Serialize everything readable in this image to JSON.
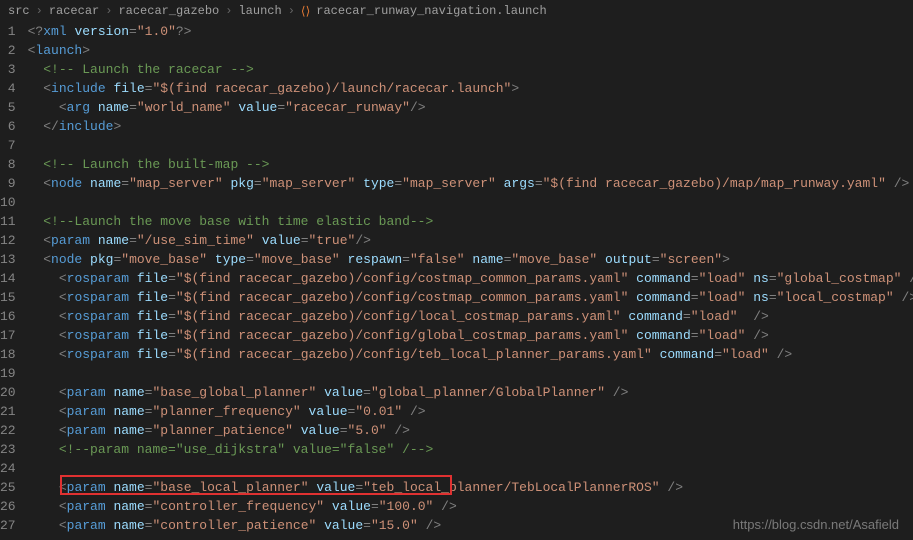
{
  "breadcrumb": {
    "items": [
      "src",
      "racecar",
      "racecar_gazebo",
      "launch",
      "racecar_runway_navigation.launch"
    ]
  },
  "gutter": {
    "start": 1,
    "end": 27
  },
  "code_lines": [
    {
      "i": 1,
      "tokens": [
        [
          "punc",
          "<?"
        ],
        [
          "tag",
          "xml "
        ],
        [
          "attr",
          "version"
        ],
        [
          "punc",
          "="
        ],
        [
          "str",
          "\"1.0\""
        ],
        [
          "punc",
          "?>"
        ]
      ]
    },
    {
      "i": 2,
      "tokens": [
        [
          "punc",
          "<"
        ],
        [
          "tag",
          "launch"
        ],
        [
          "punc",
          ">"
        ]
      ]
    },
    {
      "i": 3,
      "tokens": [
        [
          "txt",
          "  "
        ],
        [
          "cmt",
          "<!-- Launch the racecar -->"
        ]
      ]
    },
    {
      "i": 4,
      "tokens": [
        [
          "txt",
          "  "
        ],
        [
          "punc",
          "<"
        ],
        [
          "tag",
          "include "
        ],
        [
          "attr",
          "file"
        ],
        [
          "punc",
          "="
        ],
        [
          "str",
          "\"$(find racecar_gazebo)/launch/racecar.launch\""
        ],
        [
          "punc",
          ">"
        ]
      ]
    },
    {
      "i": 5,
      "tokens": [
        [
          "txt",
          "    "
        ],
        [
          "punc",
          "<"
        ],
        [
          "tag",
          "arg "
        ],
        [
          "attr",
          "name"
        ],
        [
          "punc",
          "="
        ],
        [
          "str",
          "\"world_name\" "
        ],
        [
          "attr",
          "value"
        ],
        [
          "punc",
          "="
        ],
        [
          "str",
          "\"racecar_runway\""
        ],
        [
          "punc",
          "/>"
        ]
      ]
    },
    {
      "i": 6,
      "tokens": [
        [
          "txt",
          "  "
        ],
        [
          "punc",
          "</"
        ],
        [
          "tag",
          "include"
        ],
        [
          "punc",
          ">"
        ]
      ]
    },
    {
      "i": 7,
      "tokens": []
    },
    {
      "i": 8,
      "tokens": [
        [
          "txt",
          "  "
        ],
        [
          "cmt",
          "<!-- Launch the built-map -->"
        ]
      ]
    },
    {
      "i": 9,
      "tokens": [
        [
          "txt",
          "  "
        ],
        [
          "punc",
          "<"
        ],
        [
          "tag",
          "node "
        ],
        [
          "attr",
          "name"
        ],
        [
          "punc",
          "="
        ],
        [
          "str",
          "\"map_server\" "
        ],
        [
          "attr",
          "pkg"
        ],
        [
          "punc",
          "="
        ],
        [
          "str",
          "\"map_server\" "
        ],
        [
          "attr",
          "type"
        ],
        [
          "punc",
          "="
        ],
        [
          "str",
          "\"map_server\" "
        ],
        [
          "attr",
          "args"
        ],
        [
          "punc",
          "="
        ],
        [
          "str",
          "\"$(find racecar_gazebo)/map/map_runway.yaml\" "
        ],
        [
          "punc",
          "/>"
        ]
      ]
    },
    {
      "i": 10,
      "tokens": []
    },
    {
      "i": 11,
      "tokens": [
        [
          "txt",
          "  "
        ],
        [
          "cmt",
          "<!--Launch the move base with time elastic band-->"
        ]
      ]
    },
    {
      "i": 12,
      "tokens": [
        [
          "txt",
          "  "
        ],
        [
          "punc",
          "<"
        ],
        [
          "tag",
          "param "
        ],
        [
          "attr",
          "name"
        ],
        [
          "punc",
          "="
        ],
        [
          "str",
          "\"/use_sim_time\" "
        ],
        [
          "attr",
          "value"
        ],
        [
          "punc",
          "="
        ],
        [
          "str",
          "\"true\""
        ],
        [
          "punc",
          "/>"
        ]
      ]
    },
    {
      "i": 13,
      "tokens": [
        [
          "txt",
          "  "
        ],
        [
          "punc",
          "<"
        ],
        [
          "tag",
          "node "
        ],
        [
          "attr",
          "pkg"
        ],
        [
          "punc",
          "="
        ],
        [
          "str",
          "\"move_base\" "
        ],
        [
          "attr",
          "type"
        ],
        [
          "punc",
          "="
        ],
        [
          "str",
          "\"move_base\" "
        ],
        [
          "attr",
          "respawn"
        ],
        [
          "punc",
          "="
        ],
        [
          "str",
          "\"false\" "
        ],
        [
          "attr",
          "name"
        ],
        [
          "punc",
          "="
        ],
        [
          "str",
          "\"move_base\" "
        ],
        [
          "attr",
          "output"
        ],
        [
          "punc",
          "="
        ],
        [
          "str",
          "\"screen\""
        ],
        [
          "punc",
          ">"
        ]
      ]
    },
    {
      "i": 14,
      "tokens": [
        [
          "txt",
          "    "
        ],
        [
          "punc",
          "<"
        ],
        [
          "tag",
          "rosparam "
        ],
        [
          "attr",
          "file"
        ],
        [
          "punc",
          "="
        ],
        [
          "str",
          "\"$(find racecar_gazebo)/config/costmap_common_params.yaml\" "
        ],
        [
          "attr",
          "command"
        ],
        [
          "punc",
          "="
        ],
        [
          "str",
          "\"load\" "
        ],
        [
          "attr",
          "ns"
        ],
        [
          "punc",
          "="
        ],
        [
          "str",
          "\"global_costmap\" "
        ],
        [
          "punc",
          "/>"
        ]
      ]
    },
    {
      "i": 15,
      "tokens": [
        [
          "txt",
          "    "
        ],
        [
          "punc",
          "<"
        ],
        [
          "tag",
          "rosparam "
        ],
        [
          "attr",
          "file"
        ],
        [
          "punc",
          "="
        ],
        [
          "str",
          "\"$(find racecar_gazebo)/config/costmap_common_params.yaml\" "
        ],
        [
          "attr",
          "command"
        ],
        [
          "punc",
          "="
        ],
        [
          "str",
          "\"load\" "
        ],
        [
          "attr",
          "ns"
        ],
        [
          "punc",
          "="
        ],
        [
          "str",
          "\"local_costmap\" "
        ],
        [
          "punc",
          "/>"
        ]
      ]
    },
    {
      "i": 16,
      "tokens": [
        [
          "txt",
          "    "
        ],
        [
          "punc",
          "<"
        ],
        [
          "tag",
          "rosparam "
        ],
        [
          "attr",
          "file"
        ],
        [
          "punc",
          "="
        ],
        [
          "str",
          "\"$(find racecar_gazebo)/config/local_costmap_params.yaml\" "
        ],
        [
          "attr",
          "command"
        ],
        [
          "punc",
          "="
        ],
        [
          "str",
          "\"load\"  "
        ],
        [
          "punc",
          "/>"
        ]
      ]
    },
    {
      "i": 17,
      "tokens": [
        [
          "txt",
          "    "
        ],
        [
          "punc",
          "<"
        ],
        [
          "tag",
          "rosparam "
        ],
        [
          "attr",
          "file"
        ],
        [
          "punc",
          "="
        ],
        [
          "str",
          "\"$(find racecar_gazebo)/config/global_costmap_params.yaml\" "
        ],
        [
          "attr",
          "command"
        ],
        [
          "punc",
          "="
        ],
        [
          "str",
          "\"load\" "
        ],
        [
          "punc",
          "/>"
        ]
      ]
    },
    {
      "i": 18,
      "tokens": [
        [
          "txt",
          "    "
        ],
        [
          "punc",
          "<"
        ],
        [
          "tag",
          "rosparam "
        ],
        [
          "attr",
          "file"
        ],
        [
          "punc",
          "="
        ],
        [
          "str",
          "\"$(find racecar_gazebo)/config/teb_local_planner_params.yaml\" "
        ],
        [
          "attr",
          "command"
        ],
        [
          "punc",
          "="
        ],
        [
          "str",
          "\"load\" "
        ],
        [
          "punc",
          "/>"
        ]
      ]
    },
    {
      "i": 19,
      "tokens": []
    },
    {
      "i": 20,
      "tokens": [
        [
          "txt",
          "    "
        ],
        [
          "punc",
          "<"
        ],
        [
          "tag",
          "param "
        ],
        [
          "attr",
          "name"
        ],
        [
          "punc",
          "="
        ],
        [
          "str",
          "\"base_global_planner\" "
        ],
        [
          "attr",
          "value"
        ],
        [
          "punc",
          "="
        ],
        [
          "str",
          "\"global_planner/GlobalPlanner\" "
        ],
        [
          "punc",
          "/>"
        ]
      ]
    },
    {
      "i": 21,
      "tokens": [
        [
          "txt",
          "    "
        ],
        [
          "punc",
          "<"
        ],
        [
          "tag",
          "param "
        ],
        [
          "attr",
          "name"
        ],
        [
          "punc",
          "="
        ],
        [
          "str",
          "\"planner_frequency\" "
        ],
        [
          "attr",
          "value"
        ],
        [
          "punc",
          "="
        ],
        [
          "str",
          "\"0.01\" "
        ],
        [
          "punc",
          "/>"
        ]
      ]
    },
    {
      "i": 22,
      "tokens": [
        [
          "txt",
          "    "
        ],
        [
          "punc",
          "<"
        ],
        [
          "tag",
          "param "
        ],
        [
          "attr",
          "name"
        ],
        [
          "punc",
          "="
        ],
        [
          "str",
          "\"planner_patience\" "
        ],
        [
          "attr",
          "value"
        ],
        [
          "punc",
          "="
        ],
        [
          "str",
          "\"5.0\" "
        ],
        [
          "punc",
          "/>"
        ]
      ]
    },
    {
      "i": 23,
      "tokens": [
        [
          "txt",
          "    "
        ],
        [
          "cmt",
          "<!--param name=\"use_dijkstra\" value=\"false\" /-->"
        ]
      ]
    },
    {
      "i": 24,
      "tokens": []
    },
    {
      "i": 25,
      "tokens": [
        [
          "txt",
          "    "
        ],
        [
          "punc",
          "<"
        ],
        [
          "tag",
          "param "
        ],
        [
          "attr",
          "name"
        ],
        [
          "punc",
          "="
        ],
        [
          "str",
          "\"base_local_planner\" "
        ],
        [
          "attr",
          "value"
        ],
        [
          "punc",
          "="
        ],
        [
          "str",
          "\"teb_local_planner/TebLocalPlannerROS\" "
        ],
        [
          "punc",
          "/>"
        ]
      ]
    },
    {
      "i": 26,
      "tokens": [
        [
          "txt",
          "    "
        ],
        [
          "punc",
          "<"
        ],
        [
          "tag",
          "param "
        ],
        [
          "attr",
          "name"
        ],
        [
          "punc",
          "="
        ],
        [
          "str",
          "\"controller_frequency\" "
        ],
        [
          "attr",
          "value"
        ],
        [
          "punc",
          "="
        ],
        [
          "str",
          "\"100.0\" "
        ],
        [
          "punc",
          "/>"
        ]
      ]
    },
    {
      "i": 27,
      "tokens": [
        [
          "txt",
          "    "
        ],
        [
          "punc",
          "<"
        ],
        [
          "tag",
          "param "
        ],
        [
          "attr",
          "name"
        ],
        [
          "punc",
          "="
        ],
        [
          "str",
          "\"controller_patience\" "
        ],
        [
          "attr",
          "value"
        ],
        [
          "punc",
          "="
        ],
        [
          "str",
          "\"15.0\" "
        ],
        [
          "punc",
          "/>"
        ]
      ]
    }
  ],
  "watermark": "https://blog.csdn.net/Asafield",
  "highlight": {
    "line": 26
  }
}
